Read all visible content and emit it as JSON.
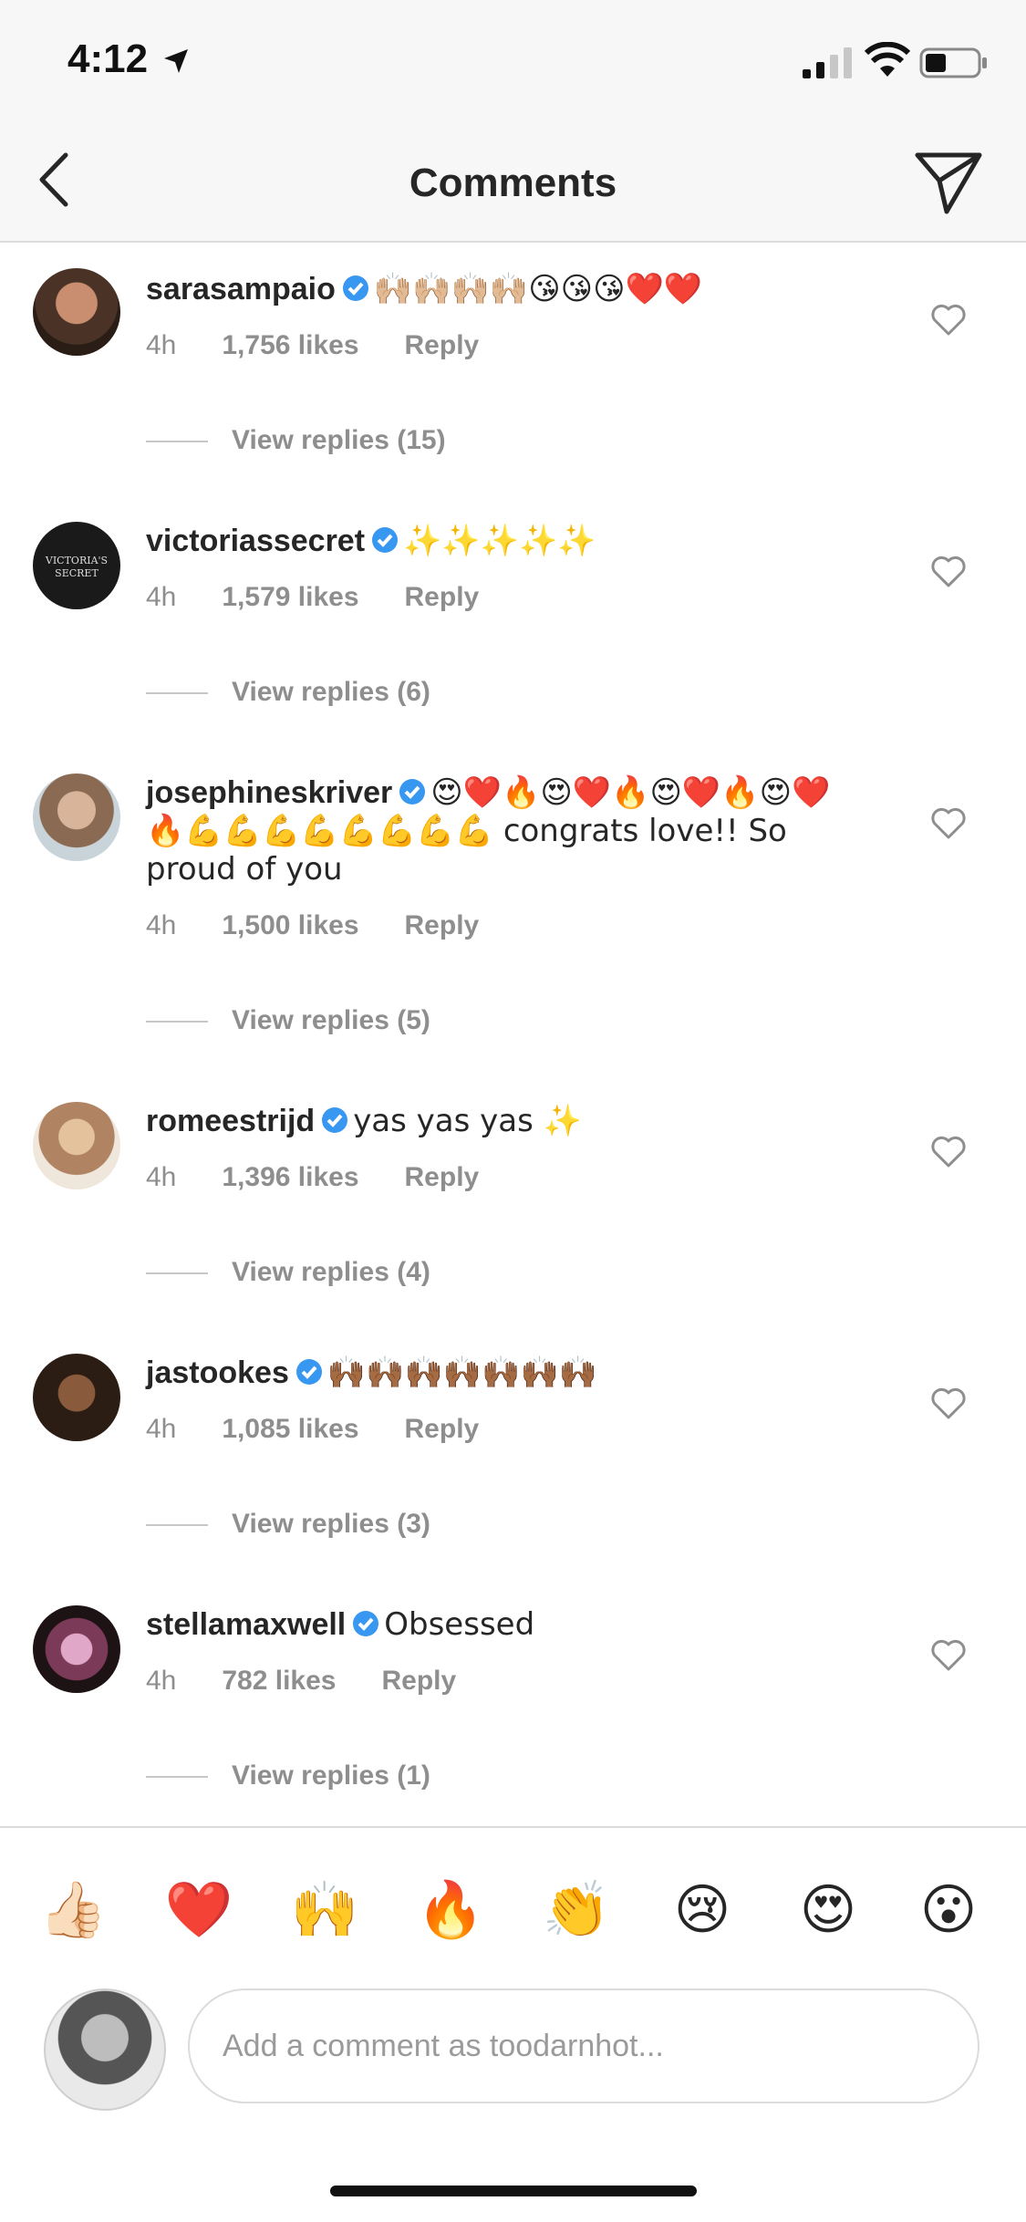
{
  "status": {
    "time": "4:12"
  },
  "nav": {
    "title": "Comments"
  },
  "comments": [
    {
      "user": "sarasampaio",
      "text": "🙌🏼🙌🏼🙌🏼🙌🏼😘😘😘❤️❤️",
      "age": "4h",
      "likes": "1,756 likes",
      "reply": "Reply",
      "replies": "View replies (15)"
    },
    {
      "user": "victoriassecret",
      "text": "✨✨✨✨✨",
      "age": "4h",
      "likes": "1,579 likes",
      "reply": "Reply",
      "replies": "View replies (6)"
    },
    {
      "user": "josephineskriver",
      "text": "😍❤️🔥😍❤️🔥😍❤️🔥😍❤️🔥💪💪💪💪💪💪💪💪 congrats love!! So proud of you",
      "age": "4h",
      "likes": "1,500 likes",
      "reply": "Reply",
      "replies": "View replies (5)"
    },
    {
      "user": "romeestrijd",
      "text": "yas yas yas ✨",
      "age": "4h",
      "likes": "1,396 likes",
      "reply": "Reply",
      "replies": "View replies (4)"
    },
    {
      "user": "jastookes",
      "text": "🙌🏾🙌🏾🙌🏾🙌🏾🙌🏾🙌🏾🙌🏾",
      "age": "4h",
      "likes": "1,085 likes",
      "reply": "Reply",
      "replies": "View replies (3)"
    },
    {
      "user": "stellamaxwell",
      "text": "Obsessed",
      "age": "4h",
      "likes": "782 likes",
      "reply": "Reply",
      "replies": "View replies (1)"
    }
  ],
  "quick_emojis": [
    "👍🏻",
    "❤️",
    "🙌",
    "🔥",
    "👏",
    "😢",
    "😍",
    "😮"
  ],
  "composer": {
    "placeholder": "Add a comment as toodarnhot..."
  },
  "colors": {
    "verified": "#3897f0",
    "muted": "#8e8e8e",
    "text": "#262626"
  },
  "icons": {
    "location": "location-arrow-icon",
    "back": "chevron-left-icon",
    "send": "paper-plane-icon",
    "like": "heart-outline-icon",
    "verified": "verified-badge-icon"
  }
}
